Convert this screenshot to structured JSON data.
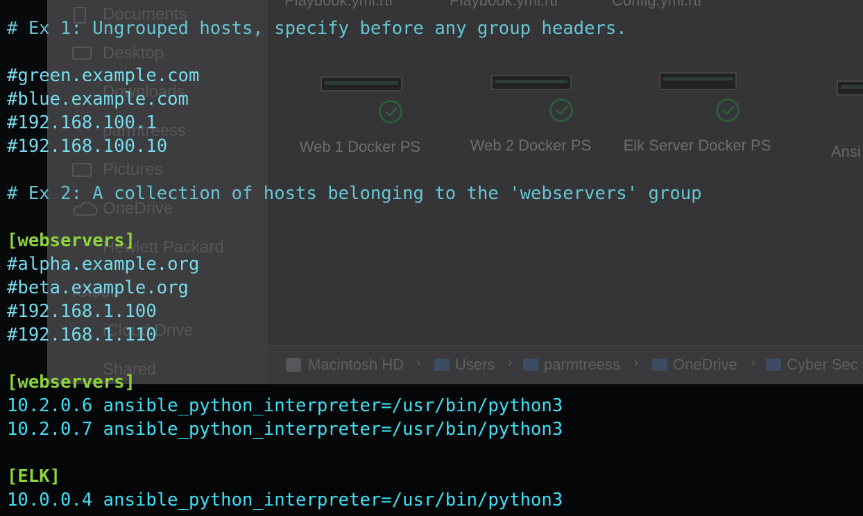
{
  "finder": {
    "top_labels": [
      "Playbook.yml.rtf",
      "Playbook.yml.rtf",
      "Config.yml.rtf"
    ],
    "sidebar": [
      {
        "label": "Documents",
        "icon": "document-icon"
      },
      {
        "label": "Desktop",
        "icon": "desktop-icon"
      },
      {
        "label": "Downloads",
        "icon": "download-icon"
      },
      {
        "label": "parmtreess",
        "icon": "home-icon"
      },
      {
        "label": "Pictures",
        "icon": "pictures-icon"
      },
      {
        "label": "OneDrive",
        "icon": "cloud-icon"
      },
      {
        "label": "Hewlett Packard",
        "icon": "folder-icon"
      },
      {
        "label": "iCloud",
        "icon": "icloud-icon"
      },
      {
        "label": "iCloud Drive",
        "icon": "icloud-drive-icon"
      },
      {
        "label": "Shared",
        "icon": "shared-icon"
      }
    ],
    "files": [
      {
        "label": "Web 1 Docker PS"
      },
      {
        "label": "Web 2 Docker PS"
      },
      {
        "label": "Elk Server Docker PS"
      },
      {
        "label": "Ansi"
      }
    ],
    "path": [
      "Macintosh HD",
      "Users",
      "parmtreess",
      "OneDrive",
      "Cyber Sec"
    ],
    "colors": {
      "sidebar": "#3d3d3f",
      "content": "#353537",
      "check": "#2e5d3a"
    }
  },
  "terminal": {
    "lines": [
      {
        "type": "comment",
        "text": "# Ex 1: Ungrouped hosts, specify before any group headers."
      },
      {
        "type": "blank",
        "text": ""
      },
      {
        "type": "host",
        "text": "#green.example.com"
      },
      {
        "type": "host",
        "text": "#blue.example.com"
      },
      {
        "type": "host",
        "text": "#192.168.100.1"
      },
      {
        "type": "host",
        "text": "#192.168.100.10"
      },
      {
        "type": "blank",
        "text": ""
      },
      {
        "type": "comment",
        "text": "# Ex 2: A collection of hosts belonging to the 'webservers' group"
      },
      {
        "type": "blank",
        "text": ""
      },
      {
        "type": "group",
        "text": "[webservers]"
      },
      {
        "type": "host",
        "text": "#alpha.example.org"
      },
      {
        "type": "host",
        "text": "#beta.example.org"
      },
      {
        "type": "host",
        "text": "#192.168.1.100"
      },
      {
        "type": "host",
        "text": "#192.168.1.110"
      },
      {
        "type": "blank",
        "text": ""
      },
      {
        "type": "group",
        "text": "[webservers]"
      },
      {
        "type": "line",
        "text": "10.2.0.6 ansible_python_interpreter=/usr/bin/python3"
      },
      {
        "type": "line",
        "text": "10.2.0.7 ansible_python_interpreter=/usr/bin/python3"
      },
      {
        "type": "blank",
        "text": ""
      },
      {
        "type": "group",
        "text": "[ELK]"
      },
      {
        "type": "line",
        "text": "10.0.0.4 ansible_python_interpreter=/usr/bin/python3"
      }
    ],
    "colors": {
      "comment": "#66c6d6",
      "host": "#76dcec",
      "group": "#8ed33b",
      "line": "#3fe0f5",
      "background": "#07090b"
    }
  }
}
